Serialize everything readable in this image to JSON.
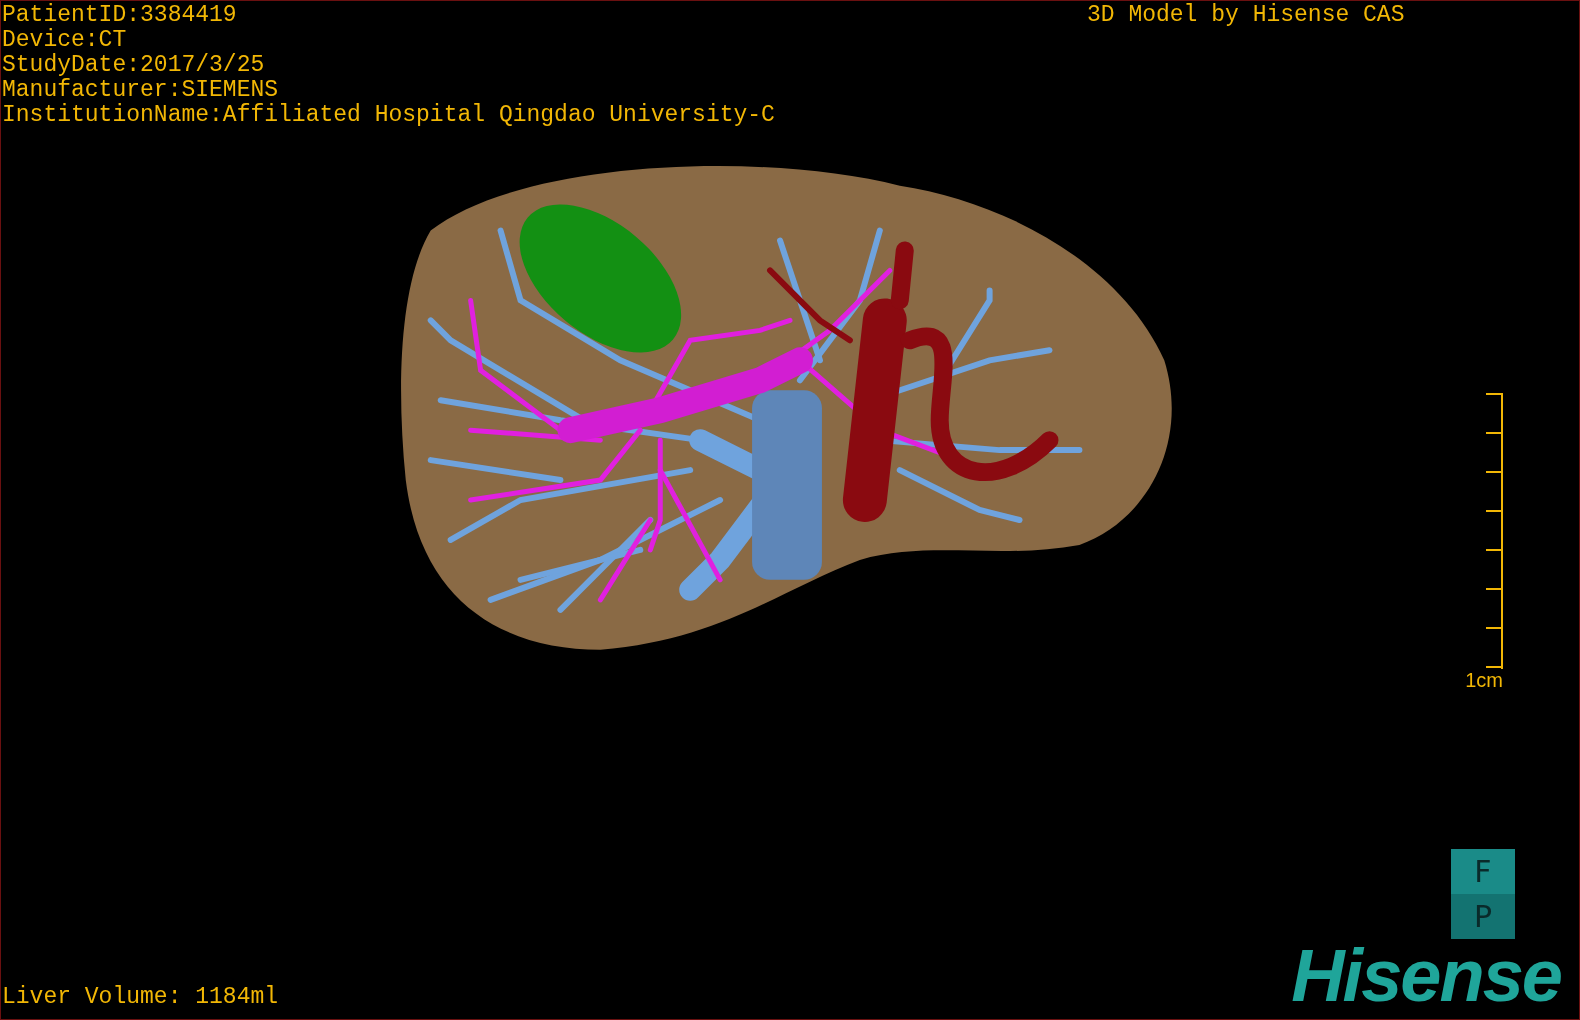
{
  "patient_info": [
    "PatientID:3384419",
    "Device:CT",
    "StudyDate:2017/3/25",
    "Manufacturer:SIEMENS",
    "InstitutionName:Affiliated Hospital Qingdao University-C"
  ],
  "model_title": "3D Model by Hisense CAS",
  "scale_bar": {
    "label": "1cm"
  },
  "orientation_cube": [
    "F",
    "P"
  ],
  "logo": "Hisense",
  "liver_volume": "Liver Volume: 1184ml"
}
